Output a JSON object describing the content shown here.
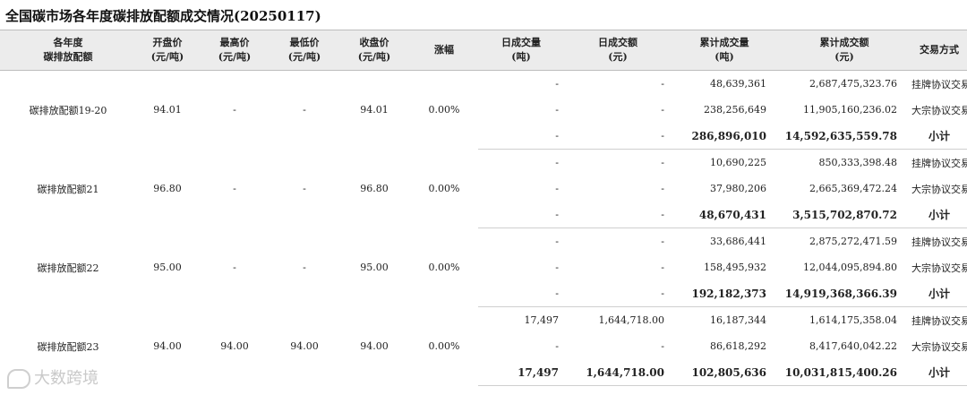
{
  "title": "全国碳市场各年度碳排放配额成交情况(20250117)",
  "headers": [
    [
      "各年度",
      "碳排放配额"
    ],
    [
      "开盘价",
      "(元/吨)"
    ],
    [
      "最高价",
      "(元/吨)"
    ],
    [
      "最低价",
      "(元/吨)"
    ],
    [
      "收盘价",
      "(元/吨)"
    ],
    [
      "涨幅"
    ],
    [
      "日成交量",
      "(吨)"
    ],
    [
      "日成交额",
      "(元)"
    ],
    [
      "累计成交量",
      "(吨)"
    ],
    [
      "累计成交额",
      "(元)"
    ],
    [
      "交易方式"
    ]
  ],
  "groups": [
    {
      "name": "碳排放配额19-20",
      "open": "94.01",
      "high": "-",
      "low": "-",
      "close": "94.01",
      "change": "0.00%",
      "rows": [
        {
          "vol": "-",
          "amt": "-",
          "cum_vol": "48,639,361",
          "cum_amt": "2,687,475,323.76",
          "type": "挂牌协议交易"
        },
        {
          "vol": "-",
          "amt": "-",
          "cum_vol": "238,256,649",
          "cum_amt": "11,905,160,236.02",
          "type": "大宗协议交易"
        },
        {
          "vol": "-",
          "amt": "-",
          "cum_vol": "286,896,010",
          "cum_amt": "14,592,635,559.78",
          "type": "小计"
        }
      ]
    },
    {
      "name": "碳排放配额21",
      "open": "96.80",
      "high": "-",
      "low": "-",
      "close": "96.80",
      "change": "0.00%",
      "rows": [
        {
          "vol": "-",
          "amt": "-",
          "cum_vol": "10,690,225",
          "cum_amt": "850,333,398.48",
          "type": "挂牌协议交易"
        },
        {
          "vol": "-",
          "amt": "-",
          "cum_vol": "37,980,206",
          "cum_amt": "2,665,369,472.24",
          "type": "大宗协议交易"
        },
        {
          "vol": "-",
          "amt": "-",
          "cum_vol": "48,670,431",
          "cum_amt": "3,515,702,870.72",
          "type": "小计"
        }
      ]
    },
    {
      "name": "碳排放配额22",
      "open": "95.00",
      "high": "-",
      "low": "-",
      "close": "95.00",
      "change": "0.00%",
      "rows": [
        {
          "vol": "-",
          "amt": "-",
          "cum_vol": "33,686,441",
          "cum_amt": "2,875,272,471.59",
          "type": "挂牌协议交易"
        },
        {
          "vol": "-",
          "amt": "-",
          "cum_vol": "158,495,932",
          "cum_amt": "12,044,095,894.80",
          "type": "大宗协议交易"
        },
        {
          "vol": "-",
          "amt": "-",
          "cum_vol": "192,182,373",
          "cum_amt": "14,919,368,366.39",
          "type": "小计"
        }
      ]
    },
    {
      "name": "碳排放配额23",
      "open": "94.00",
      "high": "94.00",
      "low": "94.00",
      "close": "94.00",
      "change": "0.00%",
      "rows": [
        {
          "vol": "17,497",
          "amt": "1,644,718.00",
          "cum_vol": "16,187,344",
          "cum_amt": "1,614,175,358.04",
          "type": "挂牌协议交易"
        },
        {
          "vol": "-",
          "amt": "-",
          "cum_vol": "86,618,292",
          "cum_amt": "8,417,640,042.22",
          "type": "大宗协议交易"
        },
        {
          "vol": "17,497",
          "amt": "1,644,718.00",
          "cum_vol": "102,805,636",
          "cum_amt": "10,031,815,400.26",
          "type": "小计"
        }
      ]
    }
  ],
  "watermark": "大数跨境"
}
